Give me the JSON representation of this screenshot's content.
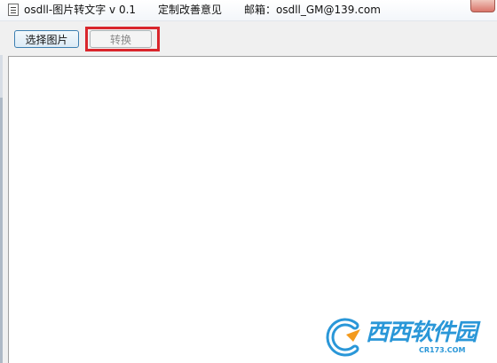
{
  "window": {
    "app_title": "osdll-图片转文字 v 0.1",
    "custom_link": "定制改善意见",
    "mail_text": "邮箱：osdll_GM@139.com"
  },
  "toolbar": {
    "select_image_label": "选择图片",
    "convert_label": "转换"
  },
  "main": {
    "output_text": ""
  },
  "watermark": {
    "brand": "西西软件园",
    "sub": "CR173.COM"
  },
  "colors": {
    "highlight": "#d9262c",
    "watermark": "#2a97d8"
  }
}
